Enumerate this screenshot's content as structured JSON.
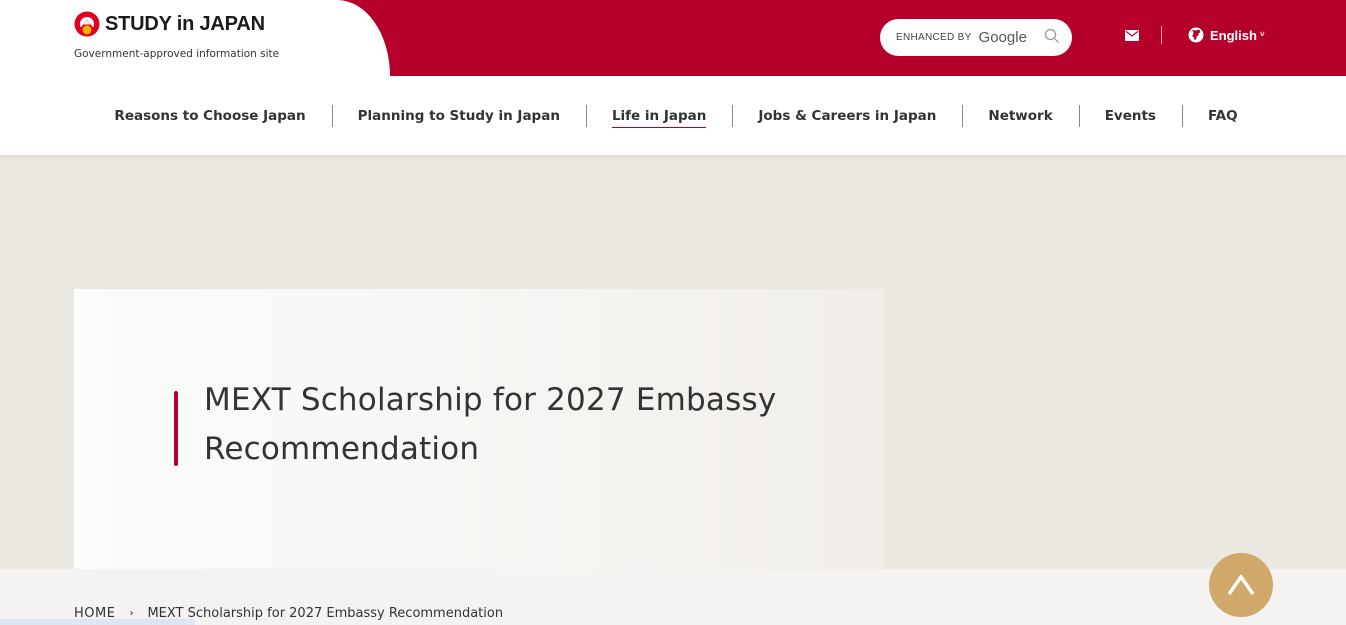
{
  "header": {
    "logo_text": "STUDY in JAPAN",
    "logo_sub": "Government-approved information site",
    "search": {
      "enhanced_by": "ENHANCED BY",
      "provider": "Google",
      "icon": "search-icon"
    },
    "contact_icon": "mail-icon",
    "language": {
      "label": "English",
      "icon": "globe-icon",
      "caret": "˅"
    }
  },
  "nav": {
    "items": [
      {
        "label": "Reasons to Choose Japan"
      },
      {
        "label": "Planning to Study in Japan"
      },
      {
        "label": "Life in Japan",
        "active": true
      },
      {
        "label": "Jobs & Careers in Japan"
      },
      {
        "label": "Network"
      },
      {
        "label": "Events"
      },
      {
        "label": "FAQ"
      }
    ]
  },
  "hero": {
    "title": "MEXT Scholarship for 2027 Embassy Recommendation"
  },
  "breadcrumb": {
    "home": "HOME",
    "separator": "›",
    "current": "MEXT Scholarship for 2027 Embassy Recommendation"
  },
  "colors": {
    "brand_red": "#b4002a",
    "back_to_top": "#d0a86a",
    "hero_bg": "#ebe7e1"
  },
  "back_to_top": {
    "icon": "arrow-up-icon"
  }
}
